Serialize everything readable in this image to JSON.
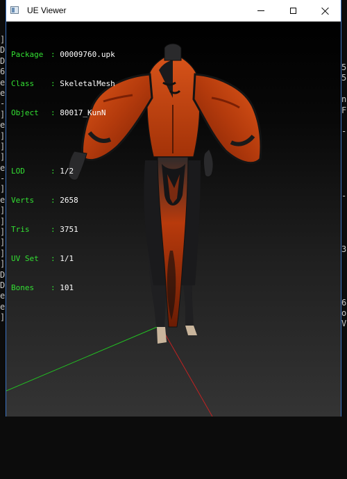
{
  "window": {
    "title": "UE Viewer"
  },
  "info": {
    "package_label": "Package",
    "package": "00009760.upk",
    "class_label": "Class",
    "class": "SkeletalMesh",
    "object_label": "Object",
    "object": "80017_KunN",
    "lod_label": "LOD",
    "lod": "1/2",
    "verts_label": "Verts",
    "verts": "2658",
    "tris_label": "Tris",
    "tris": "3751",
    "uvset_label": "UV Set",
    "uvset": "1/1",
    "bones_label": "Bones",
    "bones": "101",
    "separator": ": "
  },
  "background_console": {
    "left": [
      "]",
      "D",
      "D",
      "6",
      "e",
      "e",
      "-",
      "]",
      "e",
      "]",
      "]",
      "]",
      "e",
      "-",
      "]",
      "e",
      "]",
      "]",
      "]",
      "]",
      "]",
      "]",
      "D",
      "D",
      "e",
      "e",
      "]"
    ],
    "right": [
      "5",
      "5",
      "",
      "n",
      "F",
      "",
      "-",
      "",
      "",
      "",
      "",
      "",
      "-",
      "",
      "",
      "",
      "",
      "3",
      "",
      "",
      "",
      "",
      "6",
      "o",
      "V"
    ]
  },
  "colors": {
    "label_green": "#33e033",
    "value_white": "#ffffff",
    "axis_x": "#22c222",
    "axis_y": "#c22222",
    "axis_z": "#2222c2",
    "robe_orange": "#c4420e",
    "robe_dark": "#1d1d1f"
  }
}
